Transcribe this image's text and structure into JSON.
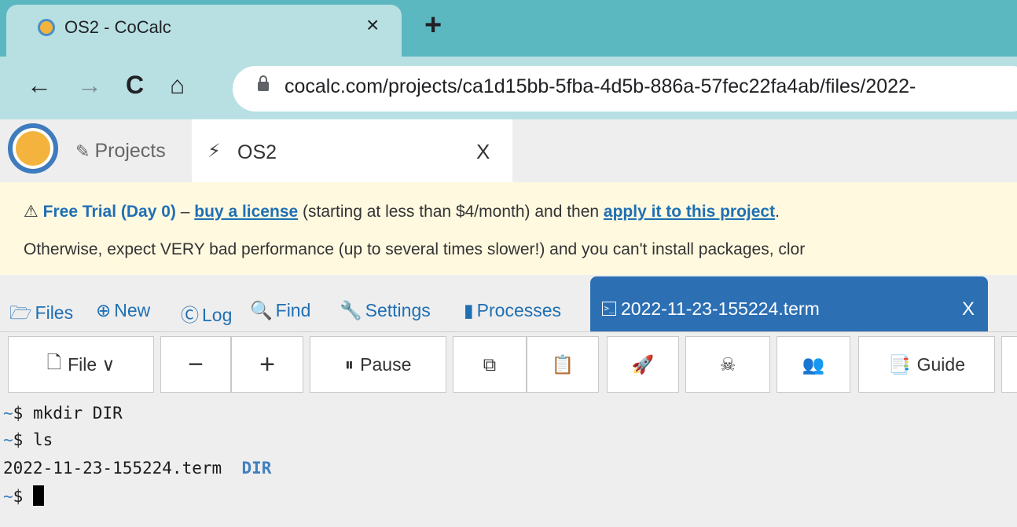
{
  "browser": {
    "tab_title": "OS2 - CoCalc",
    "tab_close": "×",
    "new_tab": "+",
    "back": "←",
    "forward": "→",
    "reload": "C",
    "home": "⌂",
    "url": "cocalc.com/projects/ca1d15bb-5fba-4d5b-886a-57fec22fa4ab/files/2022-"
  },
  "cocalc_nav": {
    "projects_icon": "✎",
    "projects_label": "Projects",
    "project_icon": "⚡",
    "project_name": "OS2",
    "project_close": "X"
  },
  "banner": {
    "warning_icon": "⚠",
    "trial_label": "Free Trial (Day 0)",
    "dash": " – ",
    "buy_link": "buy a license",
    "mid_text": " (starting at less than $4/month) and then ",
    "apply_link": "apply it to this project",
    "end_text": ".",
    "line2": "Otherwise, expect VERY bad performance (up to several times slower!) and you can't install packages, clor"
  },
  "file_tabs": {
    "files_icon": "🗁",
    "files": "Files",
    "new_icon": "⊕",
    "new": "New",
    "log_icon": "Ⓒ",
    "log": "Log",
    "find_icon": "🔍",
    "find": "Find",
    "settings_icon": "🔧",
    "settings": "Settings",
    "processes_icon": "▮",
    "processes": "Processes",
    "active_icon": ">_",
    "active_name": "2022-11-23-155224.term",
    "active_close": "X"
  },
  "toolbar": {
    "file_icon": "🗋",
    "file_label": "File ∨",
    "minus": "−",
    "plus": "+",
    "pause_icon": "⏸",
    "pause_label": "Pause",
    "copy_icon": "⧉",
    "paste_icon": "📋",
    "boot_icon": "🚀",
    "kill_icon": "☠",
    "users_icon": "👥",
    "guide_icon": "📑",
    "guide_label": "Guide"
  },
  "terminal": {
    "prompt": "~",
    "lines": [
      {
        "prompt": "$ ",
        "cmd": "mkdir DIR"
      },
      {
        "prompt": "$ ",
        "cmd": "ls"
      },
      {
        "out": "2022-11-23-155224.term  ",
        "dir": "DIR"
      },
      {
        "prompt": "$ ",
        "cmd": ""
      }
    ]
  },
  "colors": {
    "accent": "#1f6fb3",
    "active_tab": "#2c6fb3",
    "banner_bg": "#fff9e0",
    "chrome_bar": "#b8e0e3"
  }
}
